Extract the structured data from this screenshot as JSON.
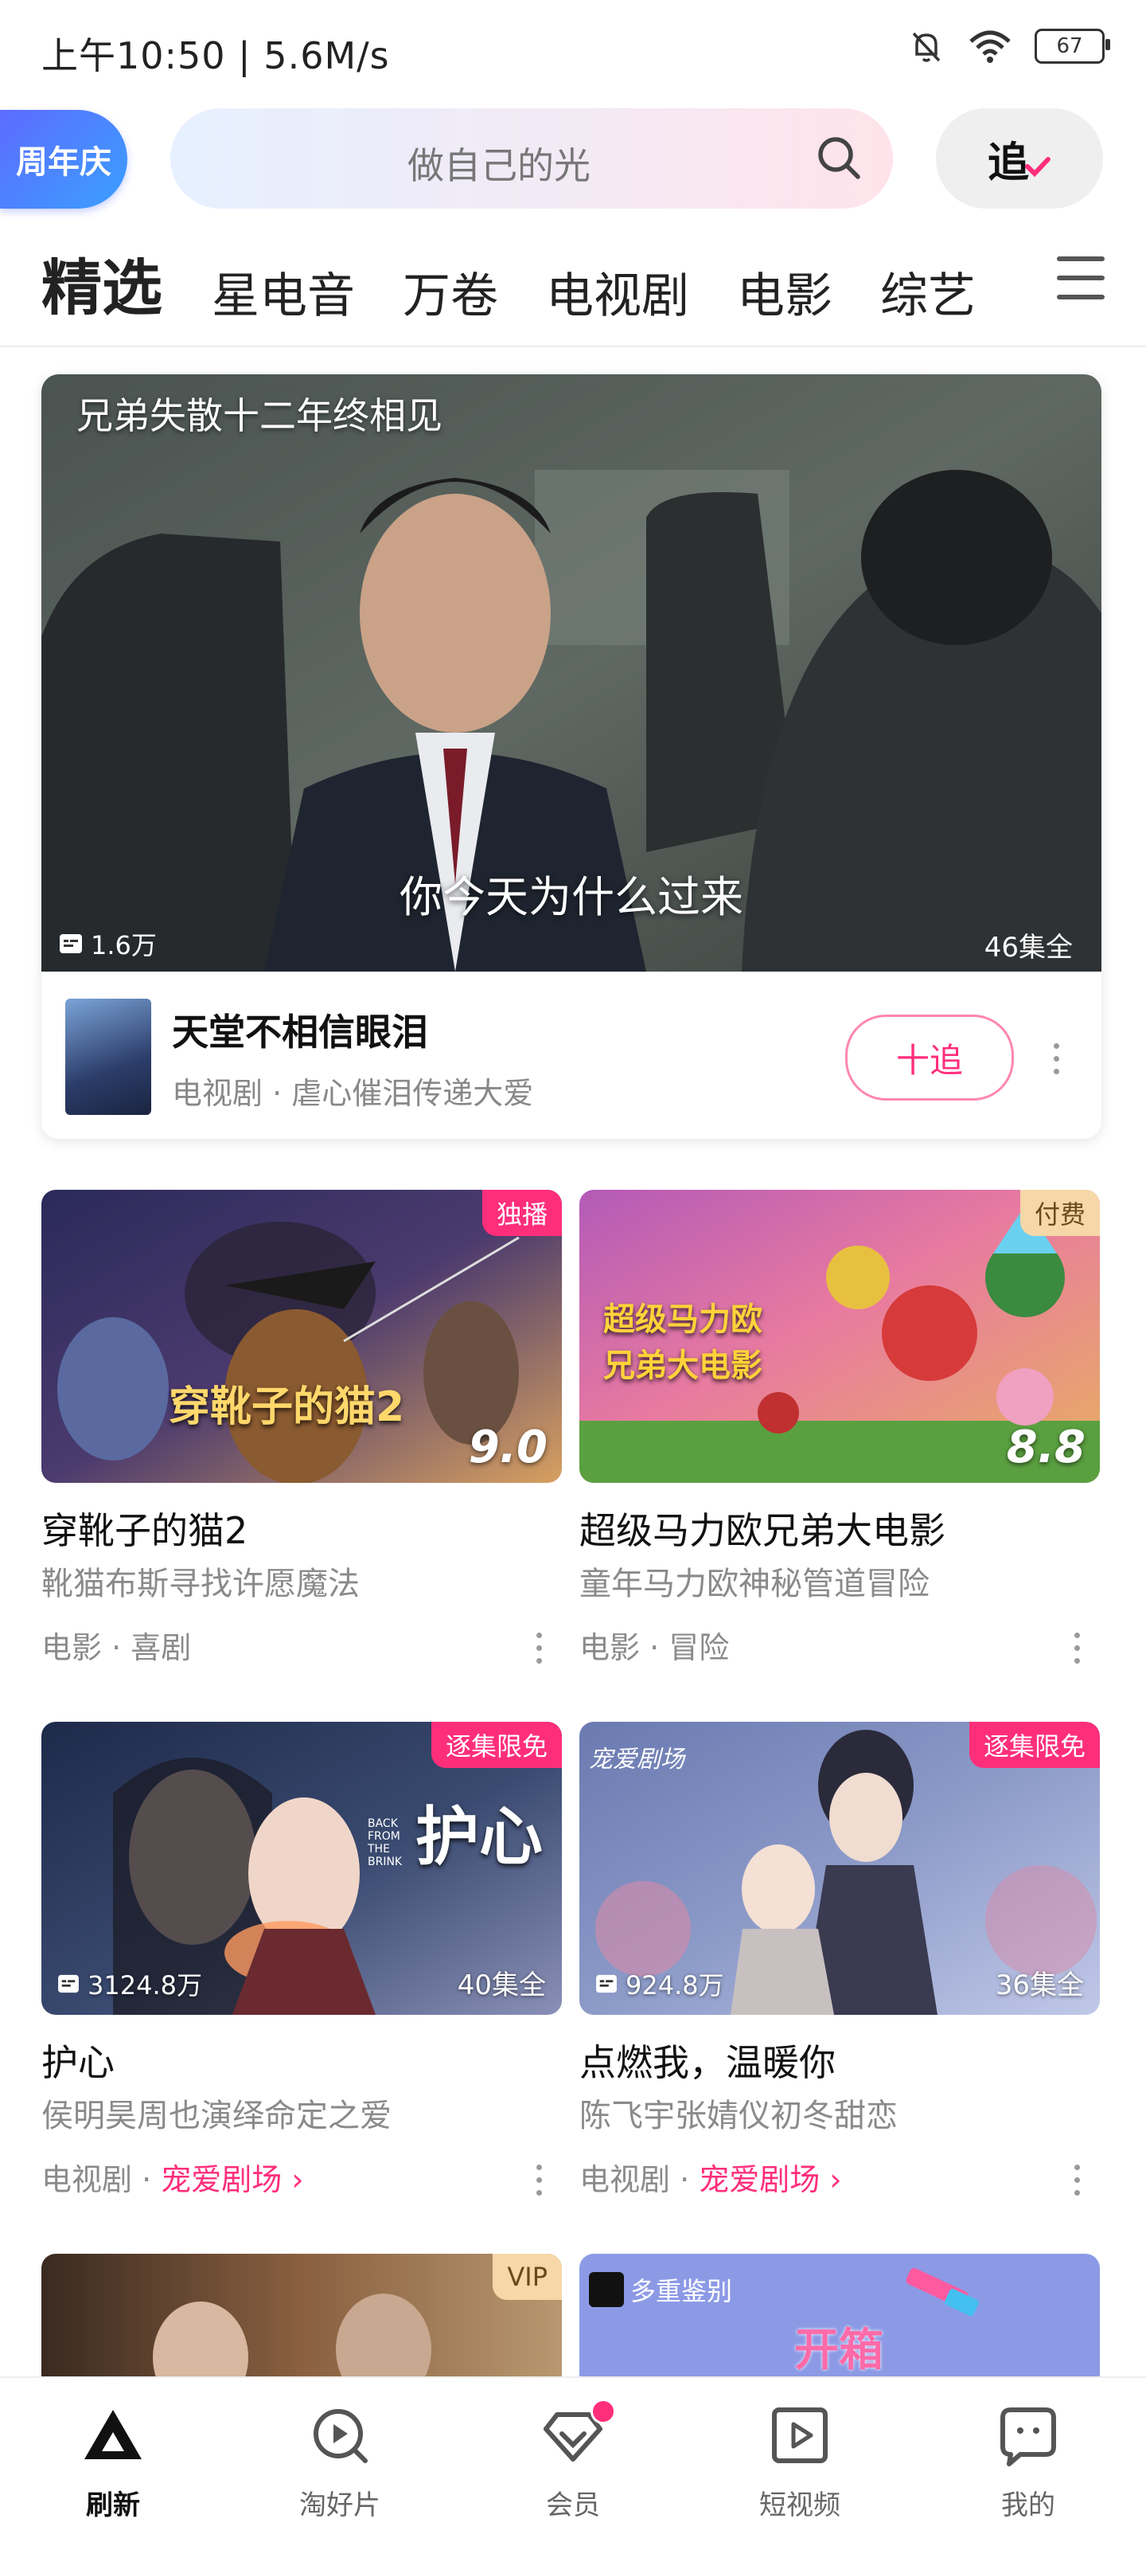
{
  "status_bar": {
    "time": "上午10:50 | 5.6M/s",
    "battery": "67"
  },
  "header": {
    "anniversary_badge": "周年庆",
    "search_placeholder": "做自己的光",
    "follow_label": "追"
  },
  "tabs": [
    {
      "label": "精选",
      "active": true
    },
    {
      "label": "星电音"
    },
    {
      "label": "万卷"
    },
    {
      "label": "电视剧"
    },
    {
      "label": "电影"
    },
    {
      "label": "综艺"
    }
  ],
  "hero": {
    "overlay_title": "兄弟失散十二年终相见",
    "subtitle": "你今天为什么过来",
    "views": "1.6万",
    "episodes": "46集全",
    "name": "天堂不相信眼泪",
    "meta": "电视剧 · 虐心催泪传递大爱",
    "follow_button": "十追"
  },
  "cards": [
    {
      "tag": "独播",
      "score": "9.0",
      "poster_text": "穿靴子的猫2",
      "title": "穿靴子的猫2",
      "desc": "靴猫布斯寻找许愿魔法",
      "category": "电影",
      "genre": "喜剧"
    },
    {
      "tag": "付费",
      "score": "8.8",
      "poster_text": "超级马力欧兄弟大电影",
      "title": "超级马力欧兄弟大电影",
      "desc": "童年马力欧神秘管道冒险",
      "category": "电影",
      "genre": "冒险"
    },
    {
      "tag": "逐集限免",
      "views": "3124.8万",
      "episodes": "40集全",
      "poster_text": "护心",
      "poster_en": "BACK FROM THE BRINK",
      "title": "护心",
      "desc": "侯明昊周也演绎命定之爱",
      "category": "电视剧",
      "link": "宠爱剧场 ›"
    },
    {
      "tag": "逐集限免",
      "views": "924.8万",
      "episodes": "36集全",
      "poster_text": "宠爱剧场",
      "title": "点燃我，温暖你",
      "desc": "陈飞宇张婧仪初冬甜恋",
      "category": "电视剧",
      "link": "宠爱剧场 ›"
    },
    {
      "tag": "VIP"
    },
    {
      "poster_badge": "多重鉴别",
      "poster_text": "开箱"
    }
  ],
  "bottom_nav": [
    {
      "label": "刷新",
      "icon": "home-triangle-icon",
      "active": true
    },
    {
      "label": "淘好片",
      "icon": "discover-icon"
    },
    {
      "label": "会员",
      "icon": "vip-diamond-icon"
    },
    {
      "label": "短视频",
      "icon": "short-video-icon"
    },
    {
      "label": "我的",
      "icon": "profile-icon"
    }
  ],
  "colors": {
    "accent": "#ff2e7b",
    "vip_gold": "#f6d7a7"
  }
}
